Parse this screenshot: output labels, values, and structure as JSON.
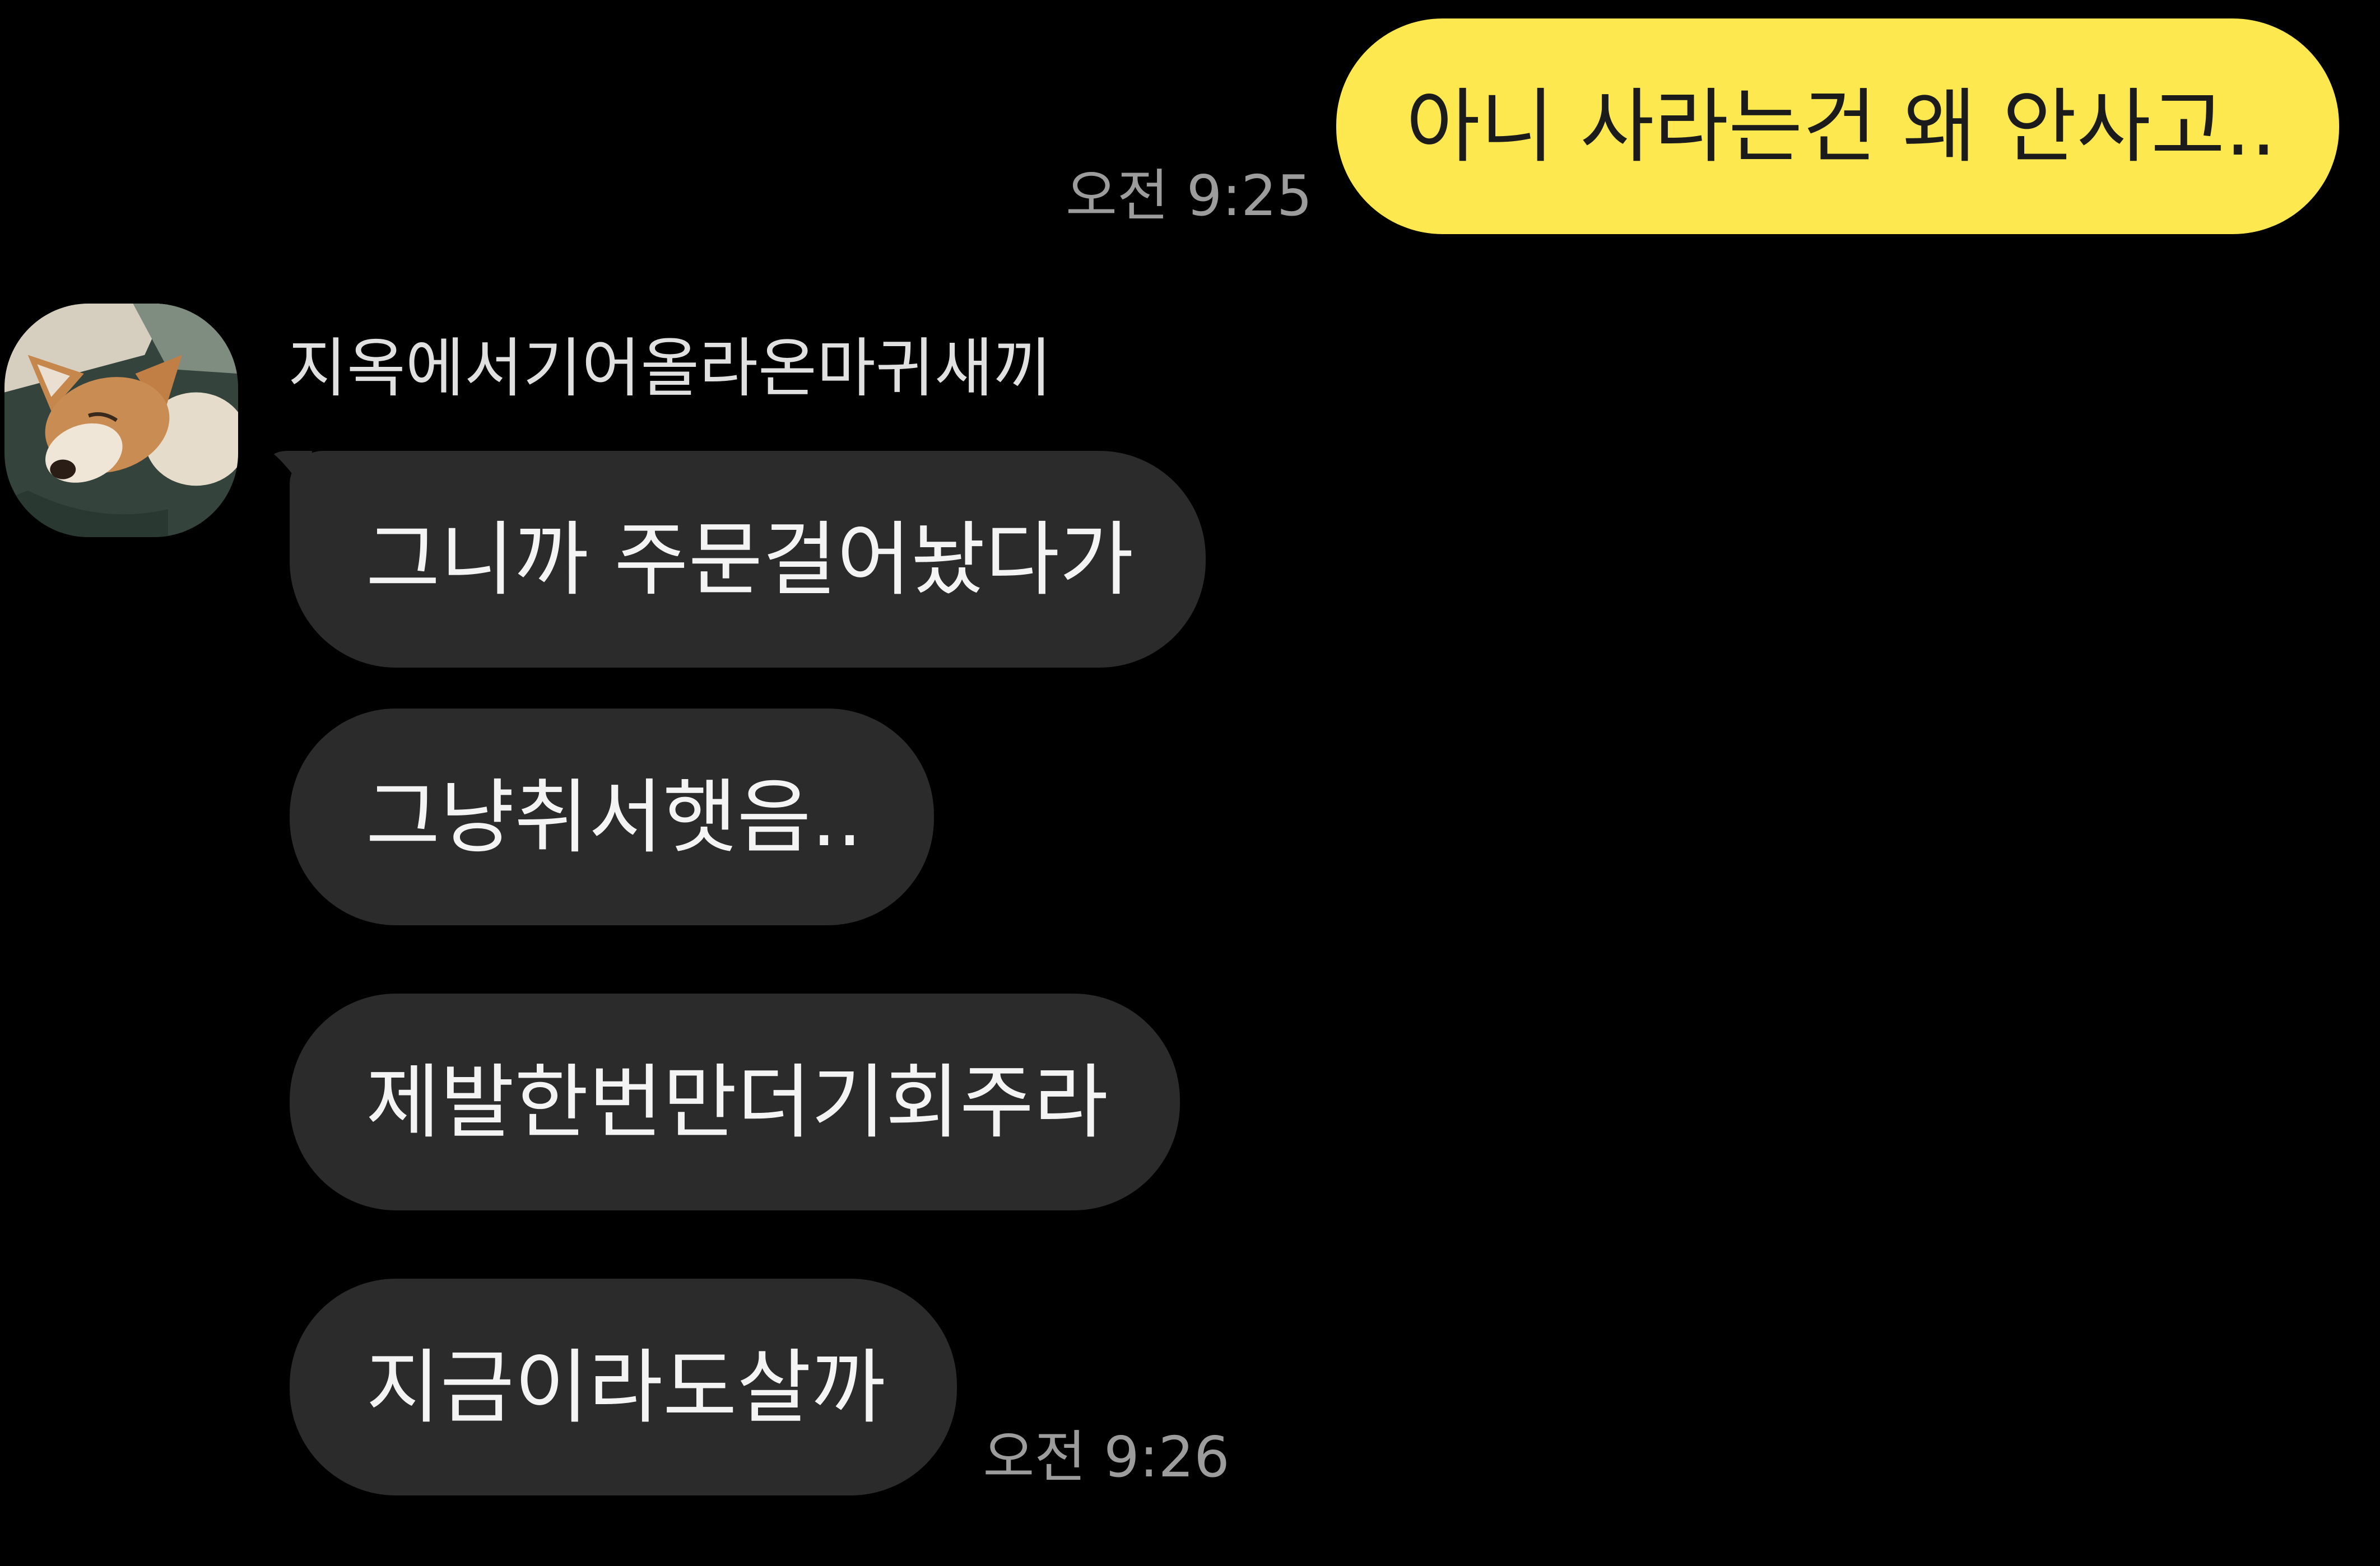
{
  "colors": {
    "background": "#000000",
    "sent_bubble": "#fde84f",
    "received_bubble": "#2b2b2b",
    "timestamp": "#9c9c9c"
  },
  "sent_messages": [
    {
      "text": "아니 사라는건 왜 안사고..",
      "time": "오전 9:25"
    }
  ],
  "received_group": {
    "sender_name": "지옥에서기어올라온마귀새끼",
    "avatar_icon": "corgi-avatar-icon",
    "messages": [
      {
        "text": "그니까 주문걸어놨다가"
      },
      {
        "text": "그냥취서햇음.."
      },
      {
        "text": "제발한번만더기회주라"
      },
      {
        "text": "지금이라도살까"
      }
    ],
    "time": "오전 9:26"
  }
}
